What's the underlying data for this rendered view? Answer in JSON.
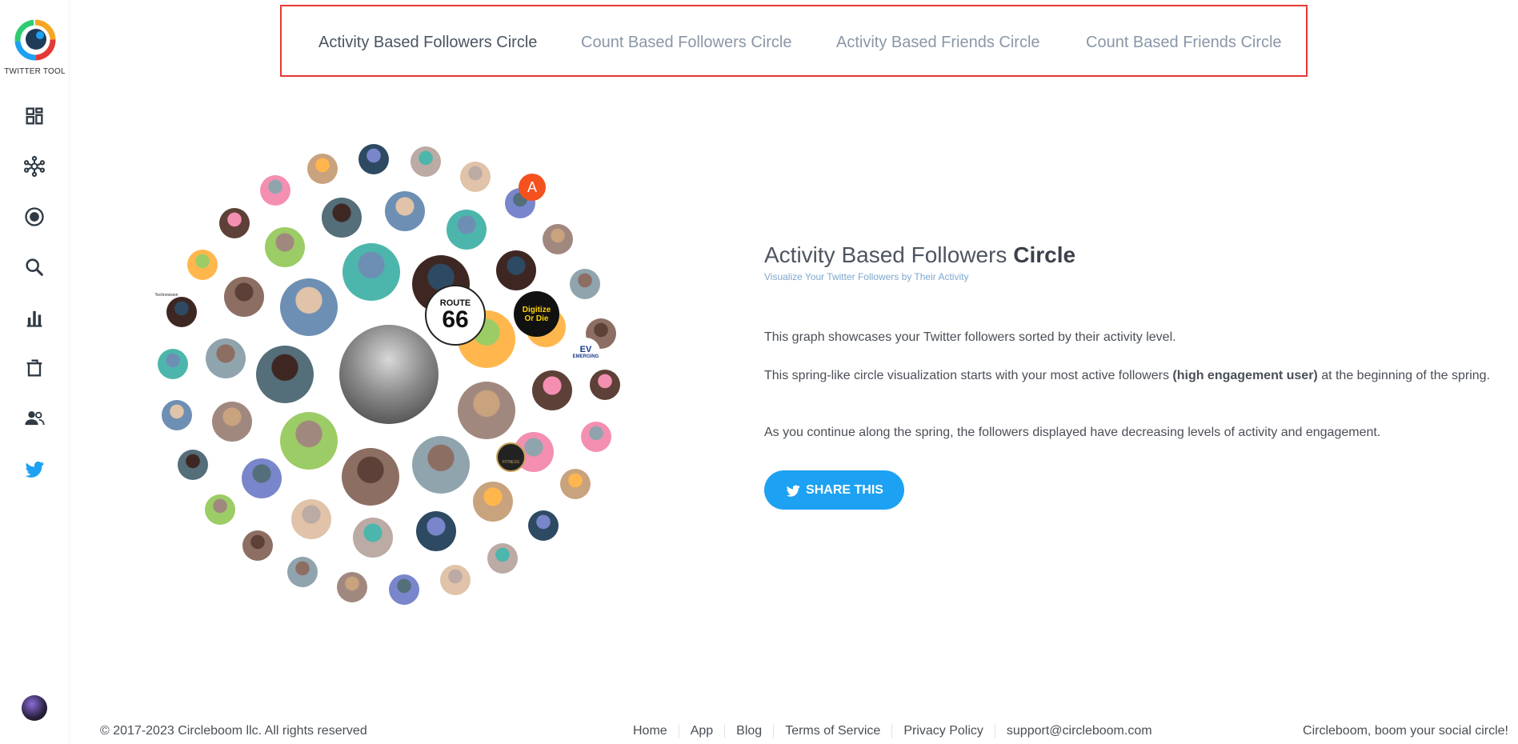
{
  "brand": {
    "label": "TWITTER TOOL",
    "colors": [
      "#f5a623",
      "#e53935",
      "#1da1f2",
      "#2ecc71"
    ]
  },
  "sidebar": {
    "items": [
      {
        "icon": "dashboard-icon"
      },
      {
        "icon": "network-icon"
      },
      {
        "icon": "radio-target-icon"
      },
      {
        "icon": "search-icon"
      },
      {
        "icon": "bar-chart-icon"
      },
      {
        "icon": "trash-icon"
      },
      {
        "icon": "people-icon"
      },
      {
        "icon": "twitter-bird-icon",
        "accent": "#1da1f2"
      }
    ],
    "user_avatar": "user-avatar-icon"
  },
  "tabs": [
    {
      "label": "Activity Based Followers Circle",
      "active": true
    },
    {
      "label": "Count Based Followers Circle",
      "active": false
    },
    {
      "label": "Activity Based Friends Circle",
      "active": false
    },
    {
      "label": "Count Based Friends Circle",
      "active": false
    }
  ],
  "circle_badges": {
    "route": "ROUTE",
    "route_number": "66",
    "digitize_1": "Digitize",
    "digitize_2": "Or Die",
    "letter_avatar": "A",
    "ev": "EV",
    "emerging": "EMERGING",
    "brand_small": "Technovision",
    "fitness": "FITNESS"
  },
  "main": {
    "title_regular": "Activity Based Followers ",
    "title_bold": "Circle",
    "subtitle": "Visualize Your Twitter Followers by Their Activity",
    "para1": "This graph showcases your Twitter followers sorted by their activity level.",
    "para2_before": "This spring-like circle visualization starts with your most active followers ",
    "para2_bold": "(high engagement user)",
    "para2_after": " at the beginning of the spring.",
    "para3": "As you continue along the spring, the followers displayed have decreasing levels of activity and engagement.",
    "share_label": "SHARE THIS",
    "share_color": "#1da1f2"
  },
  "footer": {
    "copyright": "© 2017-2023 Circleboom llc. All rights reserved",
    "links": [
      "Home",
      "App",
      "Blog",
      "Terms of Service",
      "Privacy Policy",
      "support@circleboom.com"
    ],
    "tagline": "Circleboom, boom your social circle!"
  }
}
